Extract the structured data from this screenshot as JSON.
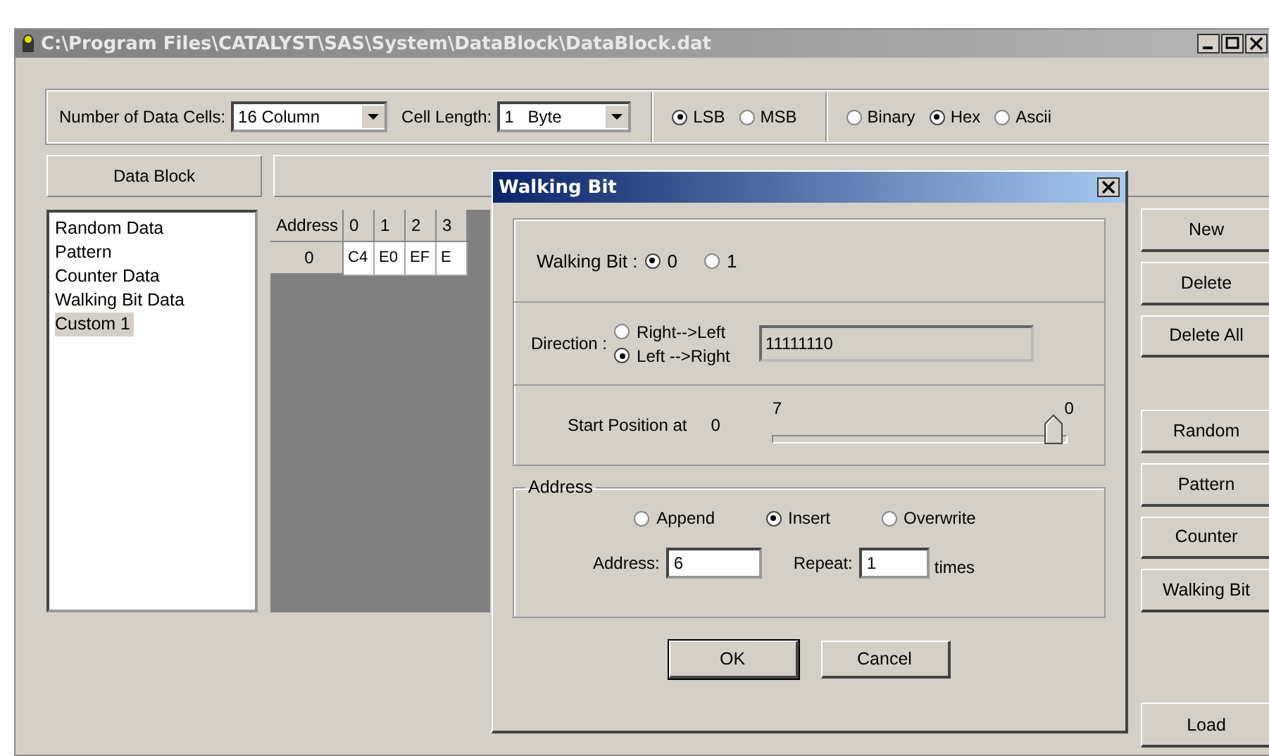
{
  "window": {
    "title": "C:\\Program Files\\CATALYST\\SAS\\System\\DataBlock\\DataBlock.dat"
  },
  "toolbar": {
    "cells_label": "Number of Data Cells:",
    "cells_value": "16 Column",
    "length_label": "Cell Length:",
    "length_value": "1   Byte",
    "bit_order": [
      {
        "label": "LSB",
        "selected": true
      },
      {
        "label": "MSB",
        "selected": false
      }
    ],
    "format": [
      {
        "label": "Binary",
        "selected": false
      },
      {
        "label": "Hex",
        "selected": true
      },
      {
        "label": "Ascii",
        "selected": false
      }
    ]
  },
  "data_block_header": "Data Block",
  "blocks": [
    {
      "label": "Random Data",
      "selected": false
    },
    {
      "label": "Pattern",
      "selected": false
    },
    {
      "label": "Counter Data",
      "selected": false
    },
    {
      "label": "Walking Bit Data",
      "selected": false
    },
    {
      "label": "Custom 1",
      "selected": true
    }
  ],
  "grid": {
    "columns": [
      "Address",
      "0",
      "1",
      "2",
      "3"
    ],
    "rows": [
      {
        "cells": [
          "0",
          "C4",
          "E0",
          "EF",
          "E"
        ]
      }
    ]
  },
  "edit_buttons": [
    "New",
    "Delete",
    "Delete All"
  ],
  "generate_buttons": [
    "Random",
    "Pattern",
    "Counter",
    "Walking Bit"
  ],
  "load_button": "Load",
  "dialog": {
    "title": "Walking Bit",
    "walking_bit": {
      "label": "Walking Bit :",
      "options": [
        {
          "label": "0",
          "selected": true
        },
        {
          "label": "1",
          "selected": false
        }
      ]
    },
    "direction": {
      "label": "Direction :",
      "options": [
        {
          "label": "Right-->Left",
          "selected": false
        },
        {
          "label": "Left -->Right",
          "selected": true
        }
      ],
      "preview": "11111110"
    },
    "start": {
      "label": "Start Position at",
      "value": "0",
      "left_tick": "7",
      "right_tick": "0",
      "level": 1
    },
    "address_group": {
      "title": "Address",
      "modes": [
        {
          "label": "Append",
          "selected": false
        },
        {
          "label": "Insert",
          "selected": true
        },
        {
          "label": "Overwrite",
          "selected": false
        }
      ],
      "address_label": "Address:",
      "address_value": "6",
      "repeat_label": "Repeat:",
      "repeat_value": "1",
      "repeat_unit": "times"
    },
    "buttons": [
      {
        "label": "OK",
        "default": true
      },
      {
        "label": "Cancel",
        "default": false
      }
    ]
  }
}
